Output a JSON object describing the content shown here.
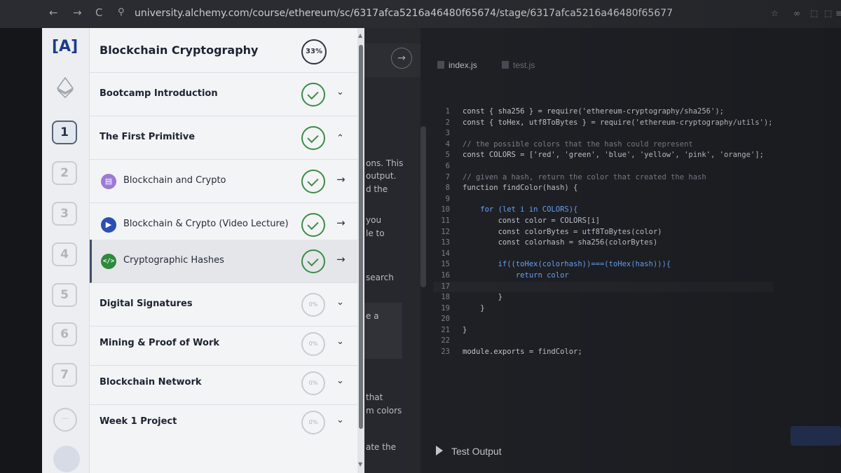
{
  "browser": {
    "url": "university.alchemy.com/course/ethereum/sc/6317afca5216a46480f65674/stage/6317afca5216a46480f65677",
    "back": "←",
    "forward": "→",
    "reload": "C",
    "lock": "⚲",
    "icons": [
      "☆",
      "∞",
      "⬚",
      "⬚",
      "≡"
    ]
  },
  "drawer": {
    "logo": "[A]",
    "course_title": "Blockchain Cryptography",
    "course_progress": "33%",
    "rail_numbers": [
      "1",
      "2",
      "3",
      "4",
      "5",
      "6",
      "7"
    ],
    "rail_more": "···",
    "sections": [
      {
        "label": "Bootcamp Introduction",
        "status": "complete",
        "chevron": "⌄"
      },
      {
        "label": "The First Primitive",
        "status": "complete",
        "chevron": "⌃"
      },
      {
        "label": "Blockchain and Crypto",
        "status": "complete",
        "arrow": "→",
        "icon": "document-icon",
        "icon_glyph": "▤"
      },
      {
        "label": "Blockchain & Crypto (Video Lecture)",
        "status": "complete",
        "arrow": "→",
        "icon": "video-icon",
        "icon_glyph": "▶"
      },
      {
        "label": "Cryptographic Hashes",
        "status": "complete",
        "arrow": "→",
        "icon": "code-icon",
        "icon_glyph": "</>"
      },
      {
        "label": "Digital Signatures",
        "progress": "0%",
        "chevron": "⌄"
      },
      {
        "label": "Mining & Proof of Work",
        "progress": "0%",
        "chevron": "⌄"
      },
      {
        "label": "Blockchain Network",
        "progress": "0%",
        "chevron": "⌄"
      },
      {
        "label": "Week 1 Project",
        "progress": "0%",
        "chevron": "⌄"
      }
    ]
  },
  "lesson": {
    "arrow": "→",
    "fragments": [
      "ons. This",
      "output.",
      "d the",
      "you",
      "le to",
      "search",
      "e a",
      "that",
      "m colors",
      "ate the"
    ]
  },
  "editor": {
    "tabs": [
      "index.js",
      "test.js"
    ],
    "line_numbers": [
      "1",
      "2",
      "3",
      "4",
      "5",
      "6",
      "7",
      "8",
      "9",
      "10",
      "11",
      "12",
      "13",
      "14",
      "15",
      "16",
      "17",
      "18",
      "19",
      "20",
      "21",
      "22",
      "23"
    ],
    "lines": [
      "const { sha256 } = require('ethereum-cryptography/sha256');",
      "const { toHex, utf8ToBytes } = require('ethereum-cryptography/utils');",
      "",
      "// the possible colors that the hash could represent",
      "const COLORS = ['red', 'green', 'blue', 'yellow', 'pink', 'orange'];",
      "",
      "// given a hash, return the color that created the hash",
      "function findColor(hash) {",
      "",
      "    for (let i in COLORS){",
      "        const color = COLORS[i]",
      "        const colorBytes = utf8ToBytes(color)",
      "        const colorhash = sha256(colorBytes)",
      "",
      "        if((toHex(colorhash))===(toHex(hash))){",
      "            return color",
      "",
      "        }",
      "    }",
      "",
      "}",
      "",
      "module.exports = findColor;"
    ],
    "test_output_label": "Test Output"
  },
  "colors": {
    "check_green": "#3d8b48",
    "brand_blue": "#1e3a8a",
    "keyword_blue": "#6fa8ff"
  }
}
